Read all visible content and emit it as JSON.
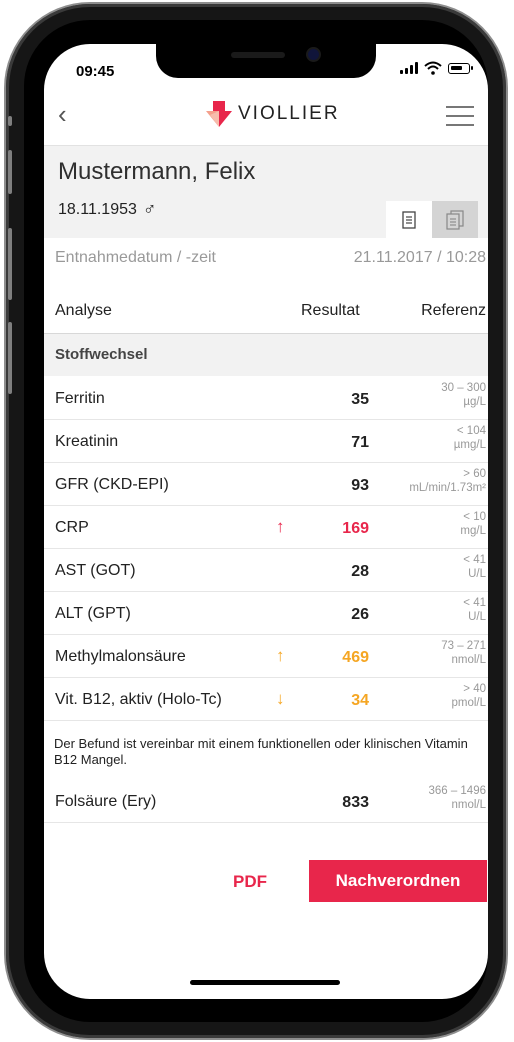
{
  "status_bar": {
    "time": "09:45"
  },
  "header": {
    "brand": "VIOLLIER"
  },
  "patient": {
    "name": "Mustermann, Felix",
    "dob": "18.11.1953",
    "sex_symbol": "♂"
  },
  "collection": {
    "label": "Entnahmedatum / -zeit",
    "value": "21.11.2017 / 10:28"
  },
  "table": {
    "col_analyse": "Analyse",
    "col_result": "Resultat",
    "col_reference": "Referenz"
  },
  "section": {
    "title": "Stoffwechsel"
  },
  "colors": {
    "accent": "#e8264b",
    "warning": "#f5a623",
    "muted": "#999999"
  },
  "rows": [
    {
      "name": "Ferritin",
      "value": "35",
      "ref_range": "30 – 300",
      "ref_unit": "µg/L",
      "flag": ""
    },
    {
      "name": "Kreatinin",
      "value": "71",
      "ref_range": "< 104",
      "ref_unit": "µmg/L",
      "flag": ""
    },
    {
      "name": "GFR (CKD-EPI)",
      "value": "93",
      "ref_range": "> 60",
      "ref_unit": "mL/min/1.73m²",
      "flag": ""
    },
    {
      "name": "CRP",
      "value": "169",
      "ref_range": "< 10",
      "ref_unit": "mg/L",
      "flag": "↑"
    },
    {
      "name": "AST (GOT)",
      "value": "28",
      "ref_range": "< 41",
      "ref_unit": "U/L",
      "flag": ""
    },
    {
      "name": "ALT (GPT)",
      "value": "26",
      "ref_range": "< 41",
      "ref_unit": "U/L",
      "flag": ""
    },
    {
      "name": "Methylmalonsäure",
      "value": "469",
      "ref_range": "73 – 271",
      "ref_unit": "nmol/L",
      "flag": "↑"
    },
    {
      "name": "Vit. B12, aktiv (Holo-Tc)",
      "value": "34",
      "ref_range": "> 40",
      "ref_unit": "pmol/L",
      "flag": "↓"
    }
  ],
  "note": "Der Befund ist vereinbar mit einem funktionellen oder klinischen Vitamin B12 Mangel.",
  "folat": {
    "name": "Folsäure (Ery)",
    "value": "833",
    "ref_range": "366 – 1496",
    "ref_unit": "nmol/L"
  },
  "actions": {
    "pdf": "PDF",
    "reorder": "Nachverordnen"
  }
}
